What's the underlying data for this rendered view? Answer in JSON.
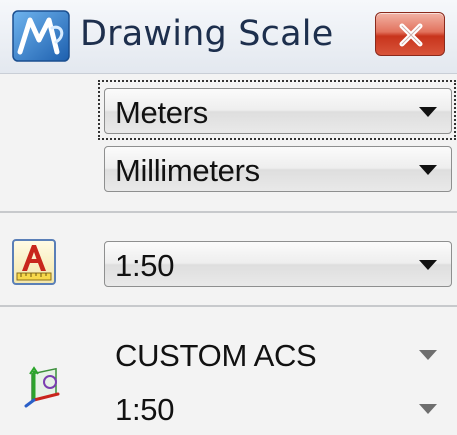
{
  "window": {
    "title": "Drawing Scale",
    "close_icon": "close-icon",
    "app_icon": "microstation-logo-icon"
  },
  "units": {
    "master_unit": "Meters",
    "sub_unit": "Millimeters"
  },
  "annotation_scale": {
    "icon": "annotation-scale-icon",
    "value": "1:50"
  },
  "acs": {
    "icon": "acs-axes-icon",
    "name": "CUSTOM ACS",
    "scale": "1:50"
  },
  "colors": {
    "close_red": "#c8341c",
    "title_text": "#1d2f4d",
    "icon_red": "#c8261c",
    "icon_yellow": "#f7d84a"
  }
}
